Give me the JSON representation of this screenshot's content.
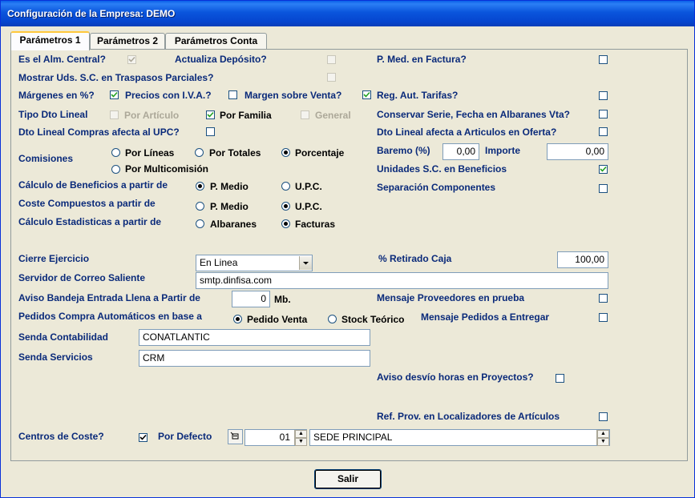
{
  "window": {
    "title": "Configuración de la Empresa: DEMO"
  },
  "tabs": [
    "Parámetros 1",
    "Parámetros 2",
    "Parámetros Conta"
  ],
  "labels": {
    "alm_central": "Es el Alm. Central?",
    "actualiza_deposito": "Actualiza Depósito?",
    "p_med_factura": "P. Med. en Factura?",
    "mostrar_uds": "Mostrar Uds. S.C. en Traspasos Parciales?",
    "margenes": "Márgenes en %?",
    "precios_iva": "Precios con I.V.A.?",
    "margen_venta": "Margen sobre Venta?",
    "reg_aut_tarifas": "Reg. Aut. Tarifas?",
    "tipo_dto_lineal": "Tipo Dto Lineal",
    "por_articulo": "Por Artículo",
    "por_familia": "Por Familia",
    "general": "General",
    "conservar_serie": "Conservar Serie, Fecha en Albaranes Vta?",
    "dto_lineal_compras": "Dto Lineal Compras afecta al UPC?",
    "dto_lineal_oferta": "Dto Lineal afecta a Articulos en Oferta?",
    "comisiones": "Comisiones",
    "por_lineas": "Por Líneas",
    "por_totales": "Por Totales",
    "porcentaje": "Porcentaje",
    "por_multicomision": "Por Multicomisión",
    "baremo": "Baremo (%)",
    "importe": "Importe",
    "unidades_sc": "Unidades S.C. en Beneficios",
    "calculo_beneficios": "Cálculo de Beneficios a partir de",
    "p_medio": "P. Medio",
    "upc": "U.P.C.",
    "separacion": "Separación Componentes",
    "coste_compuestos": "Coste Compuestos a partir de",
    "calculo_estadisticas": "Cálculo Estadisticas a partir de",
    "albaranes": "Albaranes",
    "facturas": "Facturas",
    "cierre_ejercicio": "Cierre Ejercicio",
    "retirado_caja": "% Retirado Caja",
    "servidor_correo": "Servidor de Correo Saliente",
    "aviso_bandeja": "Aviso Bandeja Entrada Llena a Partir de",
    "mb": "Mb.",
    "mensaje_proveedores": "Mensaje Proveedores en prueba",
    "pedidos_compra": "Pedidos Compra Automáticos en base a",
    "pedido_venta": "Pedido Venta",
    "stock_teorico": "Stock Teórico",
    "mensaje_pedidos": "Mensaje Pedidos a Entregar",
    "senda_contabilidad": "Senda Contabilidad",
    "senda_servicios": "Senda Servicios",
    "aviso_desvio": "Aviso desvío horas en Proyectos?",
    "ref_prov": "Ref. Prov. en Localizadores de Artículos",
    "centros_coste": "Centros de Coste?",
    "por_defecto": "Por Defecto"
  },
  "values": {
    "baremo": "0,00",
    "importe": "0,00",
    "cierre_ejercicio": "En Linea",
    "retirado_caja": "100,00",
    "servidor_correo": "smtp.dinfisa.com",
    "aviso_bandeja": "0",
    "senda_contabilidad": "CONATLANTIC",
    "senda_servicios": "CRM",
    "centro_codigo": "01",
    "centro_nombre": "SEDE PRINCIPAL"
  },
  "buttons": {
    "salir": "Salir"
  },
  "colors": {
    "label": "#0A2A7A",
    "title_bar": "#0A55DC"
  }
}
